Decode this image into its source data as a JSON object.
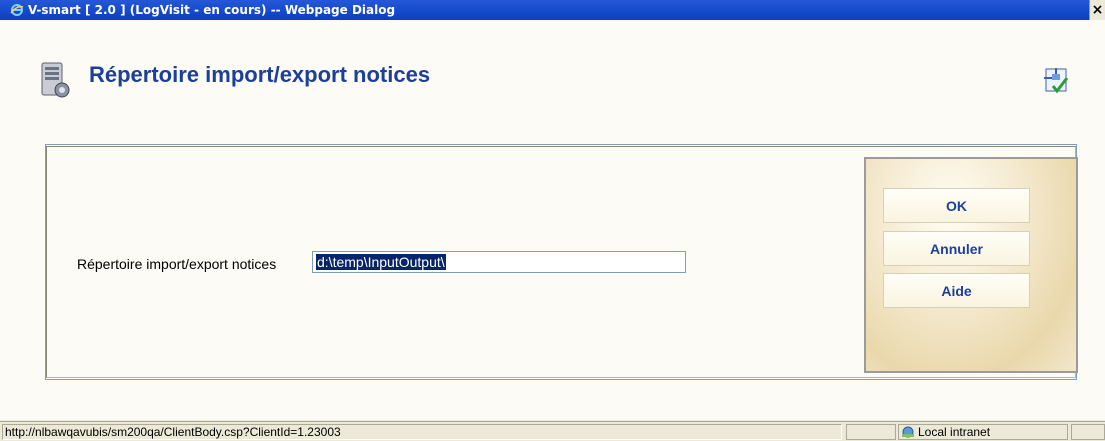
{
  "window": {
    "title": "V-smart [ 2.0 ] (LogVisit - en cours) -- Webpage Dialog",
    "close_label": "×"
  },
  "header": {
    "title": "Répertoire import/export notices"
  },
  "form": {
    "label": "Répertoire import/export notices",
    "value": "d:\\temp\\InputOutput\\"
  },
  "buttons": {
    "ok": "OK",
    "cancel": "Annuler",
    "help": "Aide"
  },
  "statusbar": {
    "url": "http://nlbawqavubis/sm200qa/ClientBody.csp?ClientId=1.23003",
    "zone": "Local intranet"
  },
  "colors": {
    "title_blue": "#1c3f9c",
    "selection": "#0a246a",
    "titlebar": "#0a3fbf"
  }
}
